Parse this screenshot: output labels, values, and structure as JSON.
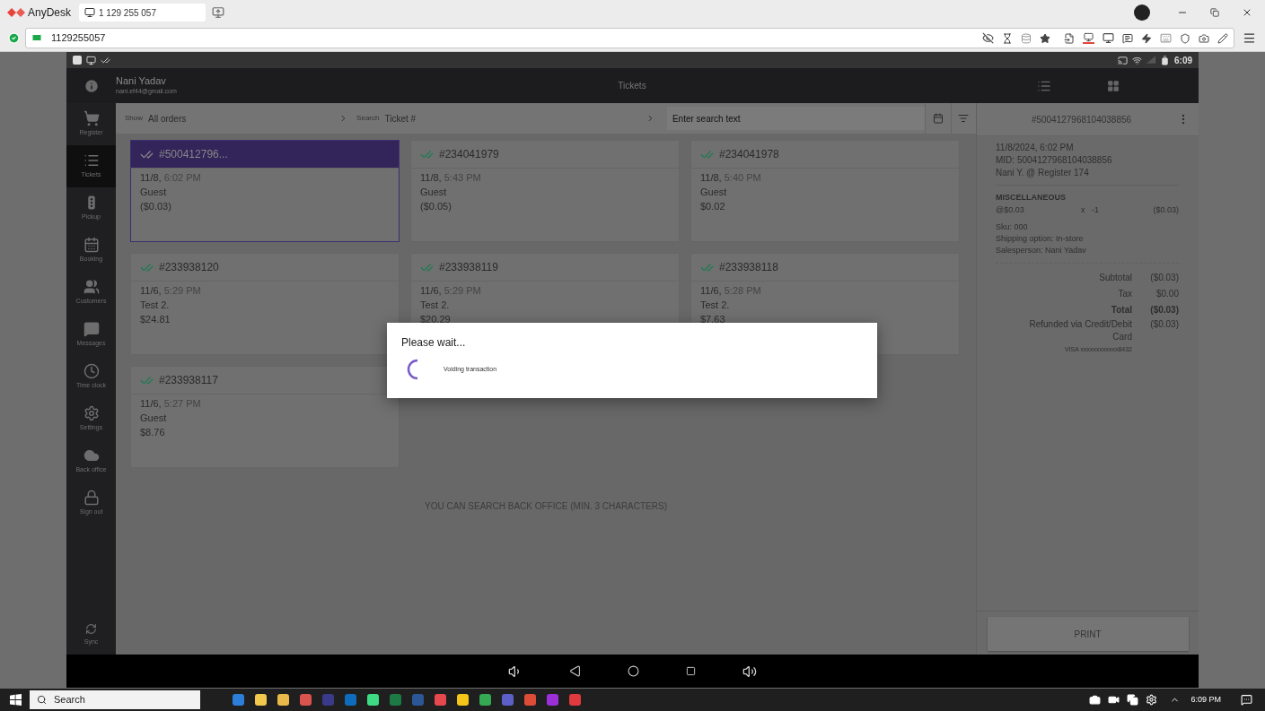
{
  "anydesk": {
    "app_name": "AnyDesk",
    "tab_label": "1 129 255 057",
    "address": "1129255057"
  },
  "status_bar": {
    "time": "6:09"
  },
  "app": {
    "user_name": "Nani Yadav",
    "user_email": "nani.ef44@gmail.com",
    "title": "Tickets",
    "sidebar": [
      {
        "kind": "cart",
        "label": "Register",
        "selected": false
      },
      {
        "kind": "list",
        "label": "Tickets",
        "selected": true
      },
      {
        "kind": "light",
        "label": "Pickup",
        "selected": false
      },
      {
        "kind": "calendar",
        "label": "Booking",
        "selected": false
      },
      {
        "kind": "people",
        "label": "Customers",
        "selected": false
      },
      {
        "kind": "chat",
        "label": "Messages",
        "selected": false
      },
      {
        "kind": "clock",
        "label": "Time clock",
        "selected": false
      },
      {
        "kind": "gear",
        "label": "Settings",
        "selected": false
      },
      {
        "kind": "cloud",
        "label": "Back office",
        "selected": false
      },
      {
        "kind": "lock",
        "label": "Sign out",
        "selected": false
      }
    ],
    "sync_label": "Sync",
    "filters": {
      "show_label": "Show",
      "show_value": "All orders",
      "search_label": "Search",
      "search_value": "Ticket #",
      "search_placeholder": "Enter search text"
    },
    "tickets": [
      {
        "number": "#500412796...",
        "selected": true,
        "date": "11/8,",
        "time": "6:02 PM",
        "customer": "Guest",
        "amount": "($0.03)"
      },
      {
        "number": "#234041979",
        "selected": false,
        "date": "11/8,",
        "time": "5:43 PM",
        "customer": "Guest",
        "amount": "($0.05)"
      },
      {
        "number": "#234041978",
        "selected": false,
        "date": "11/8,",
        "time": "5:40 PM",
        "customer": "Guest",
        "amount": "$0.02"
      },
      {
        "number": "#233938120",
        "selected": false,
        "date": "11/6,",
        "time": "5:29 PM",
        "customer": "Test 2.",
        "amount": "$24.81"
      },
      {
        "number": "#233938119",
        "selected": false,
        "date": "11/6,",
        "time": "5:29 PM",
        "customer": "Test 2.",
        "amount": "$20.29"
      },
      {
        "number": "#233938118",
        "selected": false,
        "date": "11/6,",
        "time": "5:28 PM",
        "customer": "Test 2.",
        "amount": "$7.63"
      },
      {
        "number": "#233938117",
        "selected": false,
        "date": "11/6,",
        "time": "5:27 PM",
        "customer": "Guest",
        "amount": "$8.76"
      }
    ],
    "hint": "YOU CAN SEARCH BACK OFFICE (MIN. 3 CHARACTERS)",
    "detail": {
      "title": "#5004127968104038856",
      "date": "11/8/2024, 6:02 PM",
      "mid": "MID: 5004127968104038856",
      "register": "Nani Y. @ Register 174",
      "item": {
        "name": "MISCELLANEOUS",
        "unit_price": "@$0.03",
        "quantity": "x   -1",
        "line_total": "($0.03)"
      },
      "notes": [
        "Sku: 000",
        "Shipping option: In-store",
        "Salesperson: Nani Yadav"
      ],
      "totals": [
        {
          "label": "Subtotal",
          "value": "($0.03)",
          "emphasis": false
        },
        {
          "label": "Tax",
          "value": "$0.00",
          "emphasis": false
        },
        {
          "label": "Total",
          "value": "($0.03)",
          "emphasis": true
        }
      ],
      "refund": {
        "label": "Refunded via Credit/Debit Card",
        "value": "($0.03)",
        "card": "VISA xxxxxxxxxxxx8432"
      },
      "print_button": "PRINT"
    }
  },
  "dialog": {
    "title": "Please wait...",
    "message": "Voiding transaction"
  },
  "taskbar": {
    "search_placeholder": "Search",
    "time": "6:09 PM"
  }
}
